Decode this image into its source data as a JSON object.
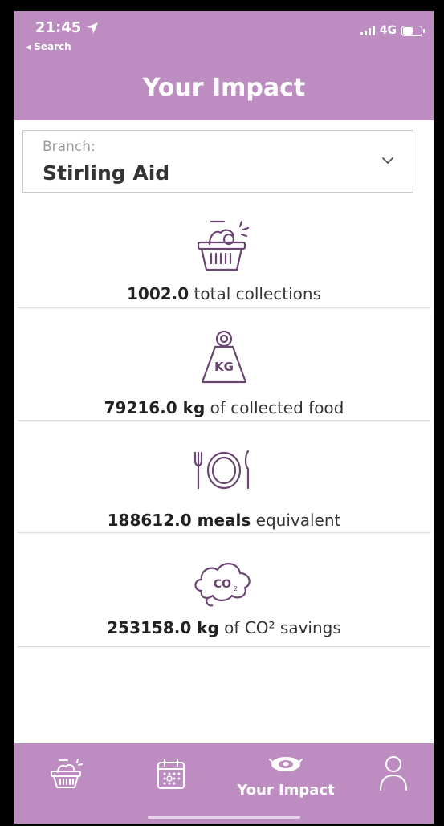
{
  "status_bar": {
    "time": "21:45",
    "back_label": "◂ Search",
    "network": "4G"
  },
  "header": {
    "title": "Your Impact"
  },
  "branch": {
    "label": "Branch:",
    "value": "Stirling Aid"
  },
  "stats": [
    {
      "icon": "basket-icon",
      "value": "1002.0",
      "text": " total collections"
    },
    {
      "icon": "weight-kg-icon",
      "value": "79216.0 kg",
      "text": " of collected food"
    },
    {
      "icon": "plate-cutlery-icon",
      "value": "188612.0 meals",
      "text": " equivalent"
    },
    {
      "icon": "co2-cloud-icon",
      "value": "253158.0 kg",
      "text": " of CO² savings"
    }
  ],
  "tabbar": {
    "active_label": "Your Impact",
    "items": [
      "basket-icon",
      "calendar-icon",
      "impact-icon",
      "profile-icon"
    ]
  },
  "colors": {
    "accent": "#bd8dc2",
    "icon_stroke": "#6b4672"
  }
}
